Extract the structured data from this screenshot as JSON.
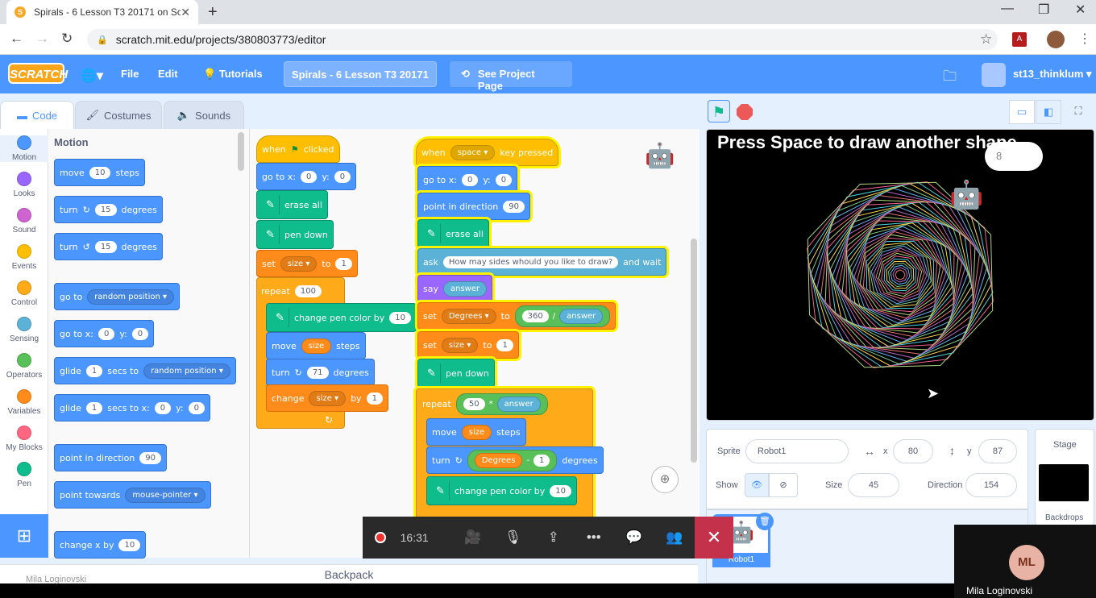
{
  "browser": {
    "tab_title": "Spirals - 6 Lesson T3 20171 on Sc",
    "url": "scratch.mit.edu/projects/380803773/editor"
  },
  "menubar": {
    "logo": "SCRATCH",
    "file": "File",
    "edit": "Edit",
    "tutorials": "Tutorials",
    "project_title": "Spirals - 6 Lesson T3 20171",
    "see_project": "See Project Page",
    "username": "st13_thinklum"
  },
  "editor_tabs": {
    "code": "Code",
    "costumes": "Costumes",
    "sounds": "Sounds"
  },
  "categories": [
    {
      "label": "Motion",
      "color": "#4c97ff"
    },
    {
      "label": "Looks",
      "color": "#9966ff"
    },
    {
      "label": "Sound",
      "color": "#cf63cf"
    },
    {
      "label": "Events",
      "color": "#ffbf00"
    },
    {
      "label": "Control",
      "color": "#ffab19"
    },
    {
      "label": "Sensing",
      "color": "#5cb1d6"
    },
    {
      "label": "Operators",
      "color": "#59c059"
    },
    {
      "label": "Variables",
      "color": "#ff8c1a"
    },
    {
      "label": "My Blocks",
      "color": "#ff6680"
    },
    {
      "label": "Pen",
      "color": "#0fbd8c"
    }
  ],
  "palette": {
    "heading": "Motion",
    "move": "move",
    "move_val": "10",
    "steps": "steps",
    "turn": "turn",
    "turn_val": "15",
    "degrees": "degrees",
    "goto": "go to",
    "random_position": "random position",
    "gotoxy": "go to x:",
    "x_val": "0",
    "y_lbl": "y:",
    "y_val": "0",
    "glide": "glide",
    "glide_val": "1",
    "secs_to": "secs to",
    "secs_to_x": "secs to x:",
    "point_dir": "point in direction",
    "dir_val": "90",
    "point_towards": "point towards",
    "mouse_pointer": "mouse-pointer",
    "change_x": "change x by",
    "change_x_val": "10"
  },
  "script1": {
    "when": "when",
    "clicked": "clicked",
    "gotoxy": "go to x:",
    "x": "0",
    "y_lbl": "y:",
    "y": "0",
    "erase_all": "erase all",
    "pen_down": "pen down",
    "set": "set",
    "size": "size",
    "to": "to",
    "one": "1",
    "repeat": "repeat",
    "repeat_val": "100",
    "change_pen_color": "change pen color by",
    "pen_color_val": "10",
    "move": "move",
    "steps": "steps",
    "turn": "turn",
    "turn_val": "71",
    "degrees": "degrees",
    "change": "change",
    "by": "by"
  },
  "script2": {
    "when": "when",
    "space": "space",
    "key_pressed": "key pressed",
    "gotoxy": "go to x:",
    "x": "0",
    "y_lbl": "y:",
    "y": "0",
    "point_dir": "point in direction",
    "dir": "90",
    "erase_all": "erase all",
    "ask": "ask",
    "question": "How may sides whould you like to draw?",
    "and_wait": "and wait",
    "say": "say",
    "answer": "answer",
    "set": "set",
    "degrees_var": "Degrees",
    "to": "to",
    "n360": "360",
    "div": "/",
    "size": "size",
    "one": "1",
    "pen_down": "pen down",
    "repeat": "repeat",
    "n50": "50",
    "times": "*",
    "move": "move",
    "steps": "steps",
    "turn": "turn",
    "minus": "-",
    "degrees": "degrees",
    "change_pen_color": "change pen color by",
    "pen_color_val": "10"
  },
  "backpack": "Backpack",
  "stage": {
    "text": "Press Space to draw another shape",
    "bubble": "8"
  },
  "sprite_info": {
    "sprite_lbl": "Sprite",
    "sprite_name": "Robot1",
    "x_lbl": "x",
    "x": "80",
    "y_lbl": "y",
    "y": "87",
    "show_lbl": "Show",
    "size_lbl": "Size",
    "size": "45",
    "direction_lbl": "Direction",
    "direction": "154",
    "thumb_name": "Robot1"
  },
  "stage_panel": {
    "title": "Stage",
    "backdrops": "Backdrops"
  },
  "call": {
    "time": "16:31",
    "participant": "Mila Loginovski",
    "initials": "ML"
  }
}
